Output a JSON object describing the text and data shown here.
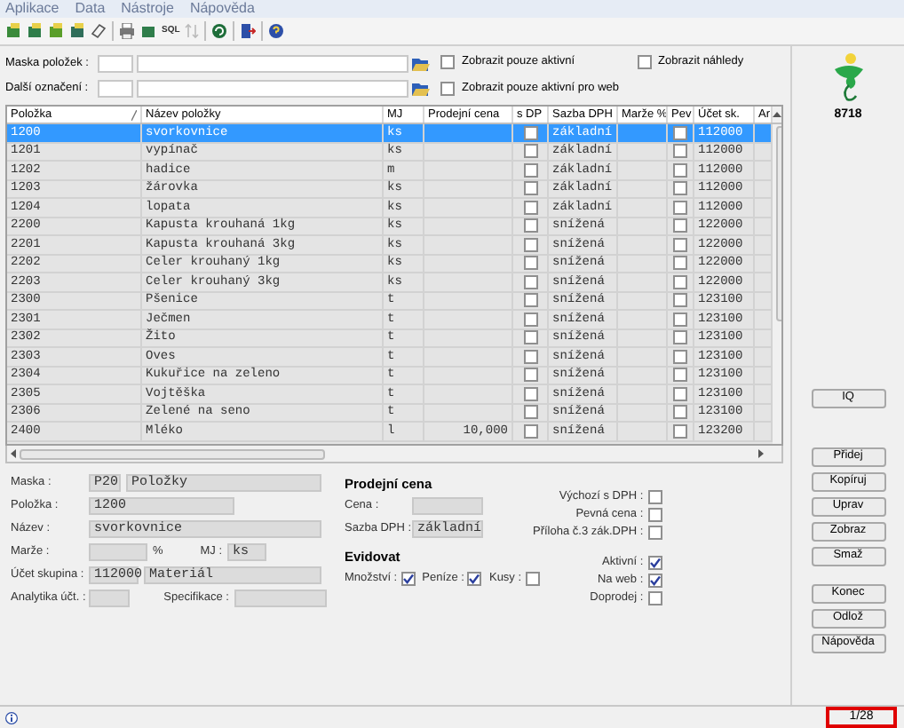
{
  "menu": [
    "Aplikace",
    "Data",
    "Nástroje",
    "Nápověda"
  ],
  "toolbar": {
    "sql_label": "SQL"
  },
  "filters": [
    {
      "label": "Maska položek :"
    },
    {
      "label": "Další označení :"
    }
  ],
  "filter_options": [
    {
      "label": "Zobrazit pouze aktivní",
      "checked": false
    },
    {
      "label": "Zobrazit náhledy",
      "checked": false
    },
    {
      "label": "Zobrazit pouze aktivní pro web",
      "checked": false
    }
  ],
  "badge": "8718",
  "table": {
    "columns": [
      "Položka",
      "Název položky",
      "MJ",
      "Prodejní cena",
      "s DP",
      "Sazba DPH",
      "Marže %",
      "Pev",
      "Účet sk.",
      "Ar"
    ],
    "rows": [
      {
        "item": "1200",
        "name": "svorkovnice",
        "mj": "ks",
        "sazba": "základní",
        "ucet": "112000",
        "s_dph": false,
        "pev": false,
        "selected": true
      },
      {
        "item": "1201",
        "name": "vypínač",
        "mj": "ks",
        "sazba": "základní",
        "ucet": "112000",
        "s_dph": false,
        "pev": false,
        "selected": false
      },
      {
        "item": "1202",
        "name": "hadice",
        "mj": "m",
        "sazba": "základní",
        "ucet": "112000",
        "s_dph": false,
        "pev": false,
        "selected": false
      },
      {
        "item": "1203",
        "name": "žárovka",
        "mj": "ks",
        "sazba": "základní",
        "ucet": "112000",
        "s_dph": false,
        "pev": false,
        "selected": false
      },
      {
        "item": "1204",
        "name": "lopata",
        "mj": "ks",
        "sazba": "základní",
        "ucet": "112000",
        "s_dph": false,
        "pev": false,
        "selected": false
      },
      {
        "item": "2200",
        "name": "Kapusta krouhaná 1kg",
        "mj": "ks",
        "sazba": "snížená",
        "ucet": "122000",
        "s_dph": false,
        "pev": false,
        "selected": false
      },
      {
        "item": "2201",
        "name": "Kapusta krouhaná 3kg",
        "mj": "ks",
        "sazba": "snížená",
        "ucet": "122000",
        "s_dph": false,
        "pev": false,
        "selected": false
      },
      {
        "item": "2202",
        "name": "Celer krouhaný 1kg",
        "mj": "ks",
        "sazba": "snížená",
        "ucet": "122000",
        "s_dph": false,
        "pev": false,
        "selected": false
      },
      {
        "item": "2203",
        "name": "Celer krouhaný 3kg",
        "mj": "ks",
        "sazba": "snížená",
        "ucet": "122000",
        "s_dph": false,
        "pev": false,
        "selected": false
      },
      {
        "item": "2300",
        "name": "Pšenice",
        "mj": "t",
        "sazba": "snížená",
        "ucet": "123100",
        "s_dph": false,
        "pev": false,
        "selected": false
      },
      {
        "item": "2301",
        "name": "Ječmen",
        "mj": "t",
        "sazba": "snížená",
        "ucet": "123100",
        "s_dph": false,
        "pev": false,
        "selected": false
      },
      {
        "item": "2302",
        "name": "Žito",
        "mj": "t",
        "sazba": "snížená",
        "ucet": "123100",
        "s_dph": false,
        "pev": false,
        "selected": false
      },
      {
        "item": "2303",
        "name": "Oves",
        "mj": "t",
        "sazba": "snížená",
        "ucet": "123100",
        "s_dph": false,
        "pev": false,
        "selected": false
      },
      {
        "item": "2304",
        "name": "Kukuřice na zeleno",
        "mj": "t",
        "sazba": "snížená",
        "ucet": "123100",
        "s_dph": false,
        "pev": false,
        "selected": false
      },
      {
        "item": "2305",
        "name": "Vojtěška",
        "mj": "t",
        "sazba": "snížená",
        "ucet": "123100",
        "s_dph": false,
        "pev": false,
        "selected": false
      },
      {
        "item": "2306",
        "name": "Zelené na seno",
        "mj": "t",
        "sazba": "snížená",
        "ucet": "123100",
        "s_dph": false,
        "pev": false,
        "selected": false
      },
      {
        "item": "2400",
        "name": "Mléko",
        "mj": "l",
        "price": "10,000",
        "sazba": "snížená",
        "ucet": "123200",
        "s_dph": false,
        "pev": false,
        "selected": false
      }
    ]
  },
  "detail": {
    "maska_label": "Maska :",
    "maska_code": "P20",
    "maska_name": "Položky",
    "polozka_label": "Položka :",
    "polozka": "1200",
    "nazev_label": "Název :",
    "nazev": "svorkovnice",
    "marze_label": "Marže :",
    "percent": "%",
    "mj_label": "MJ :",
    "mj": "ks",
    "ucet_label": "Účet skupina :",
    "ucet_code": "112000",
    "ucet_name": "Materiál",
    "analytika_label": "Analytika účt. :",
    "specifikace_label": "Specifikace :",
    "price_heading": "Prodejní cena",
    "cena_label": "Cena :",
    "sazba_label": "Sazba DPH :",
    "sazba": "základní",
    "evidovat_heading": "Evidovat",
    "evidovat": [
      {
        "label": "Množství :",
        "checked": true
      },
      {
        "label": "Peníze :",
        "checked": true
      },
      {
        "label": "Kusy :",
        "checked": false
      }
    ],
    "price_options": [
      {
        "label": "Výchozí s DPH :",
        "checked": false
      },
      {
        "label": "Pevná cena :",
        "checked": false
      },
      {
        "label": "Příloha č.3 zák.DPH :",
        "checked": false
      }
    ],
    "status_options": [
      {
        "label": "Aktivní :",
        "checked": true
      },
      {
        "label": "Na web :",
        "checked": true
      },
      {
        "label": "Doprodej :",
        "checked": false
      }
    ]
  },
  "side_buttons": [
    "IQ"
  ],
  "buttons": [
    [
      "Přidej",
      "Kopíruj",
      "Uprav",
      "Zobraz",
      "Smaž"
    ],
    [
      "Konec",
      "Odlož",
      "Nápověda"
    ]
  ],
  "status_bar": {
    "position": "1/28"
  }
}
